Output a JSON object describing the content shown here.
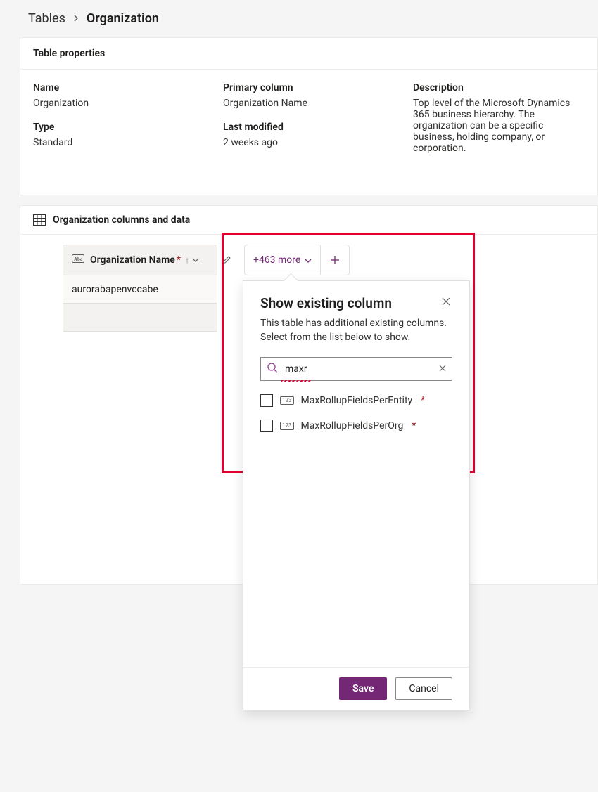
{
  "breadcrumb": {
    "parent": "Tables",
    "current": "Organization"
  },
  "properties": {
    "section_title": "Table properties",
    "name_label": "Name",
    "name_value": "Organization",
    "type_label": "Type",
    "type_value": "Standard",
    "primary_label": "Primary column",
    "primary_value": "Organization Name",
    "modified_label": "Last modified",
    "modified_value": "2 weeks ago",
    "description_label": "Description",
    "description_value": "Top level of the Microsoft Dynamics 365 business hierarchy. The organization can be a specific business, holding company, or corporation."
  },
  "columns_section": {
    "title": "Organization columns and data",
    "column_header": "Organization Name",
    "row_value": "aurorabapenvccabe",
    "more_label": "+463 more"
  },
  "flyout": {
    "title": "Show existing column",
    "description": "This table has additional existing columns. Select from the list below to show.",
    "search_value": "maxr",
    "options": [
      {
        "label": "MaxRollupFieldsPerEntity",
        "required": true
      },
      {
        "label": "MaxRollupFieldsPerOrg",
        "required": true
      }
    ],
    "save_label": "Save",
    "cancel_label": "Cancel"
  }
}
